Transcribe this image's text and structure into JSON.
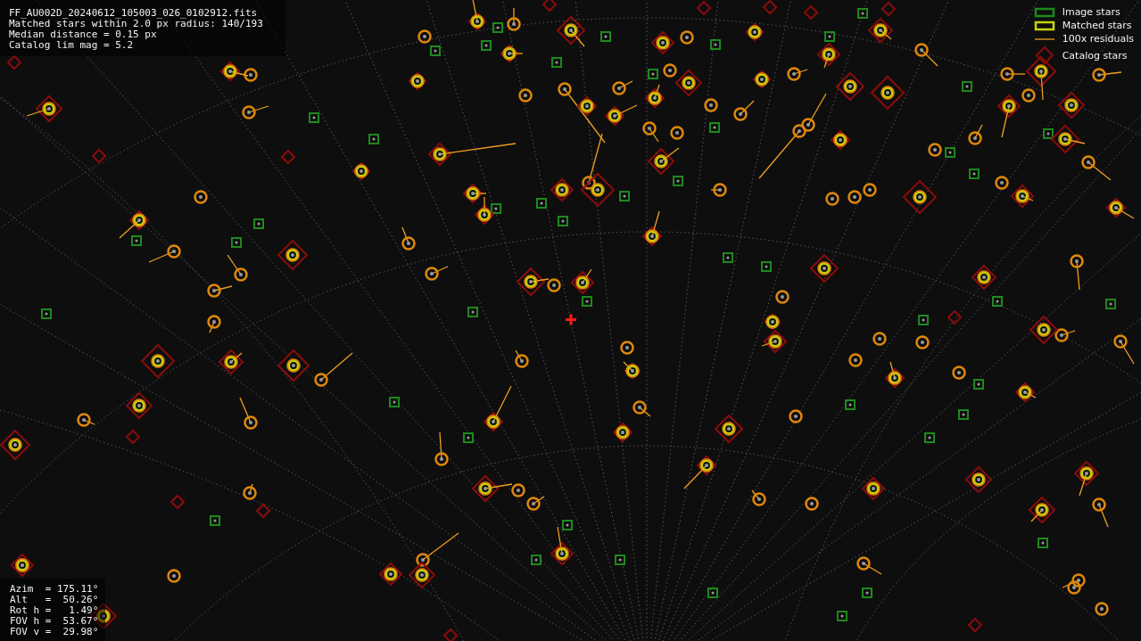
{
  "plot_info": {
    "lines": [
      "FF_AU002D_20240612_105003_026_0102912.fits",
      "Matched stars within 2.0 px radius: 140/193",
      "Median distance = 0.15 px",
      "Catalog lim mag = 5.2"
    ]
  },
  "legend": [
    {
      "kind": "image",
      "label": "Image stars"
    },
    {
      "kind": "matched",
      "label": "Matched stars"
    },
    {
      "kind": "residual",
      "label": "100x residuals"
    },
    {
      "kind": "catalog",
      "label": "Catalog stars"
    }
  ],
  "pointing": {
    "lines": [
      "Azim  = 175.11°",
      "Alt   =  50.26°",
      "Rot h =   1.49°",
      "FOV h =  53.67°",
      "FOV v =  29.98°"
    ]
  }
}
